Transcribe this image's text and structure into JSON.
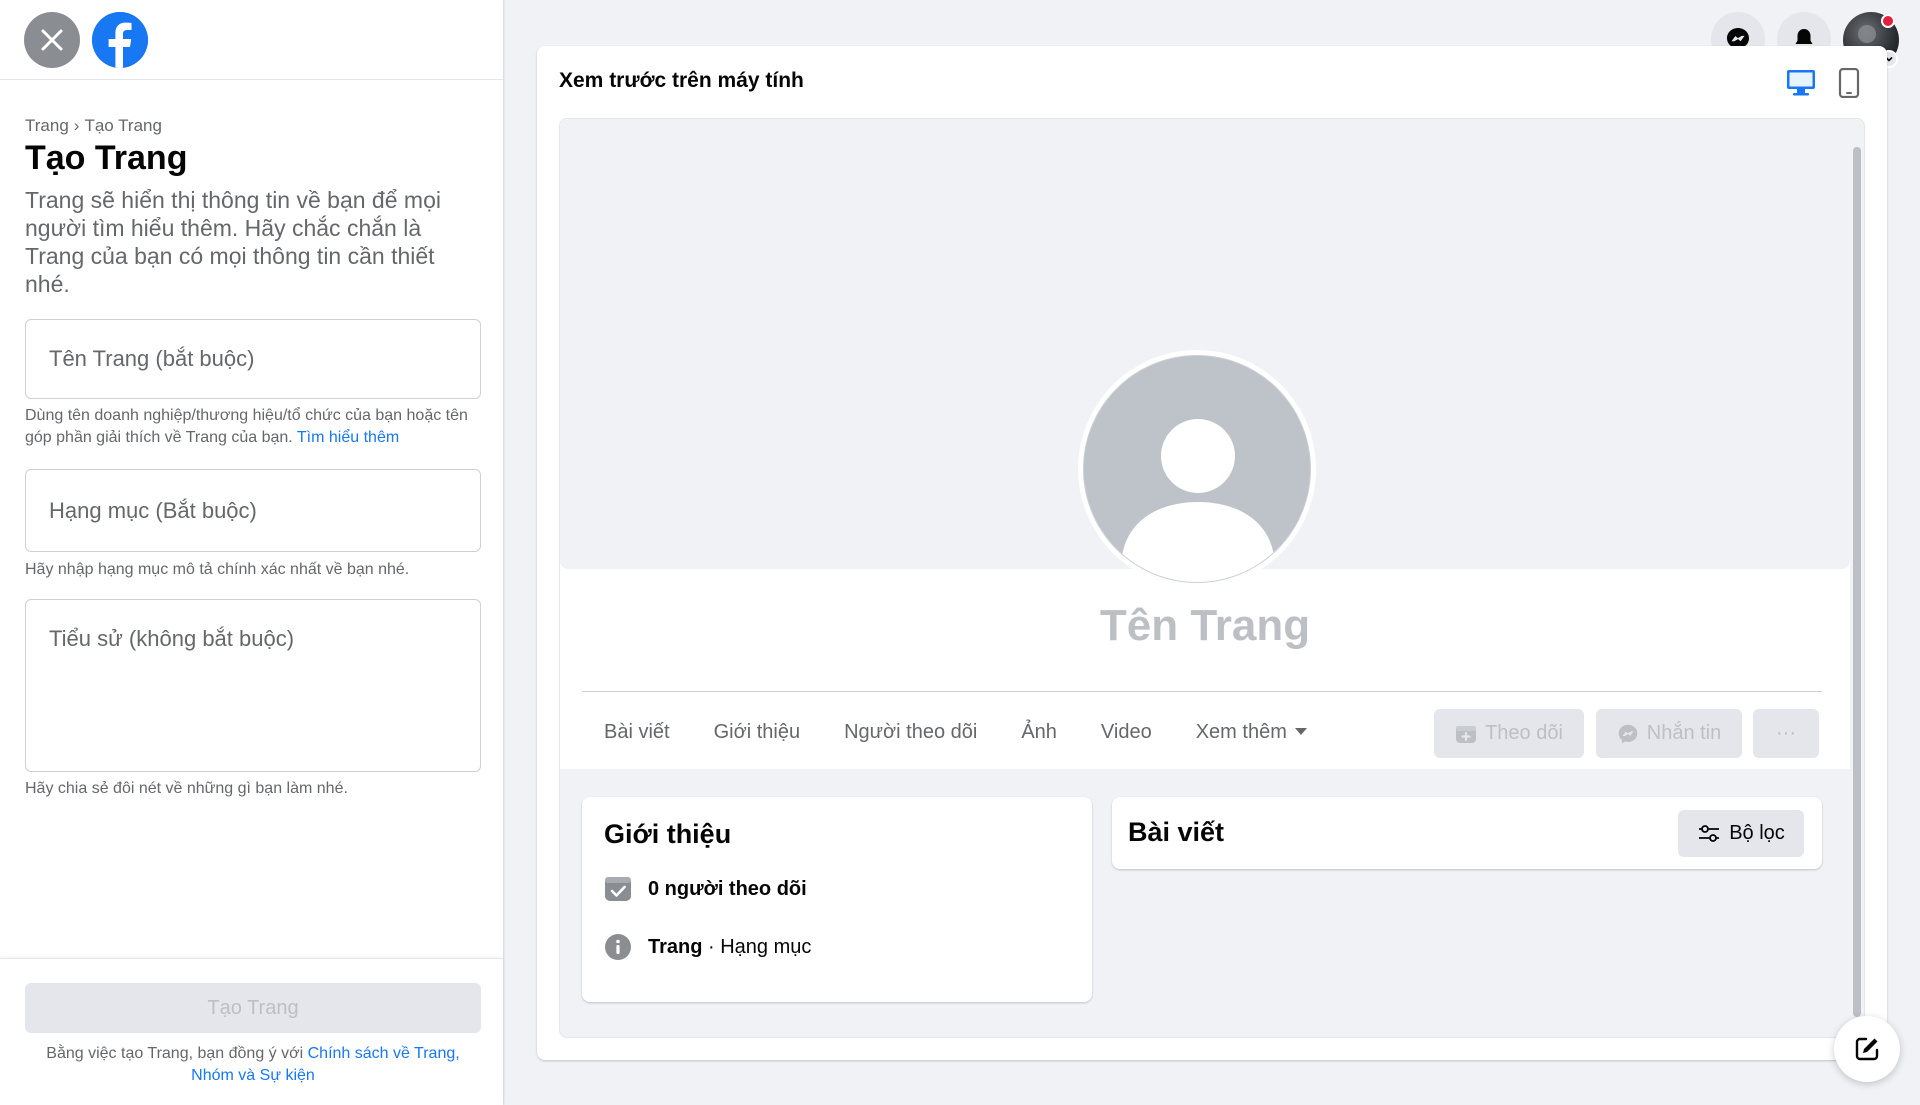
{
  "sidebar": {
    "breadcrumb": {
      "root": "Trang",
      "current": "Tạo Trang"
    },
    "title": "Tạo Trang",
    "intro": "Trang sẽ hiển thị thông tin về bạn để mọi người tìm hiểu thêm. Hãy chắc chắn là Trang của bạn có mọi thông tin cần thiết nhé.",
    "name_field": {
      "placeholder": "Tên Trang (bắt buộc)",
      "help": "Dùng tên doanh nghiệp/thương hiệu/tổ chức của bạn hoặc tên góp phần giải thích về Trang của bạn.",
      "help_link": "Tìm hiểu thêm"
    },
    "category_field": {
      "placeholder": "Hạng mục (Bắt buộc)",
      "help": "Hãy nhập hạng mục mô tả chính xác nhất về bạn nhé."
    },
    "bio_field": {
      "placeholder": "Tiểu sử (không bắt buộc)",
      "help": "Hãy chia sẻ đôi nét về những gì bạn làm nhé."
    },
    "create_button": "Tạo Trang",
    "terms_prefix": "Bằng việc tạo Trang, bạn đồng ý với",
    "terms_link": "Chính sách về Trang, Nhóm và Sự kiện"
  },
  "preview": {
    "title": "Xem trước trên máy tính",
    "page_name": "Tên Trang",
    "tabs": [
      "Bài viết",
      "Giới thiệu",
      "Người theo dõi",
      "Ảnh",
      "Video",
      "Xem thêm"
    ],
    "follow_button": "Theo dõi",
    "message_button": "Nhắn tin",
    "more_button": "···",
    "intro_card": {
      "heading": "Giới thiệu",
      "followers": "0 người theo dõi",
      "category_label": "Trang",
      "category_sep": " · ",
      "category_value": "Hạng mục"
    },
    "posts_card": {
      "heading": "Bài viết",
      "filter_button": "Bộ lọc"
    }
  },
  "colors": {
    "accent": "#1877f2",
    "notification_dot": "#e41e3f",
    "disabled_text": "#bcc0c4",
    "secondary_text": "#65676b"
  },
  "icons": [
    "close-icon",
    "facebook-logo-icon",
    "messenger-icon",
    "bell-icon",
    "desktop-icon",
    "mobile-icon",
    "follow-icon",
    "messenger-small-icon",
    "caret-down-icon",
    "followers-check-icon",
    "info-icon",
    "filter-icon",
    "edit-icon"
  ]
}
